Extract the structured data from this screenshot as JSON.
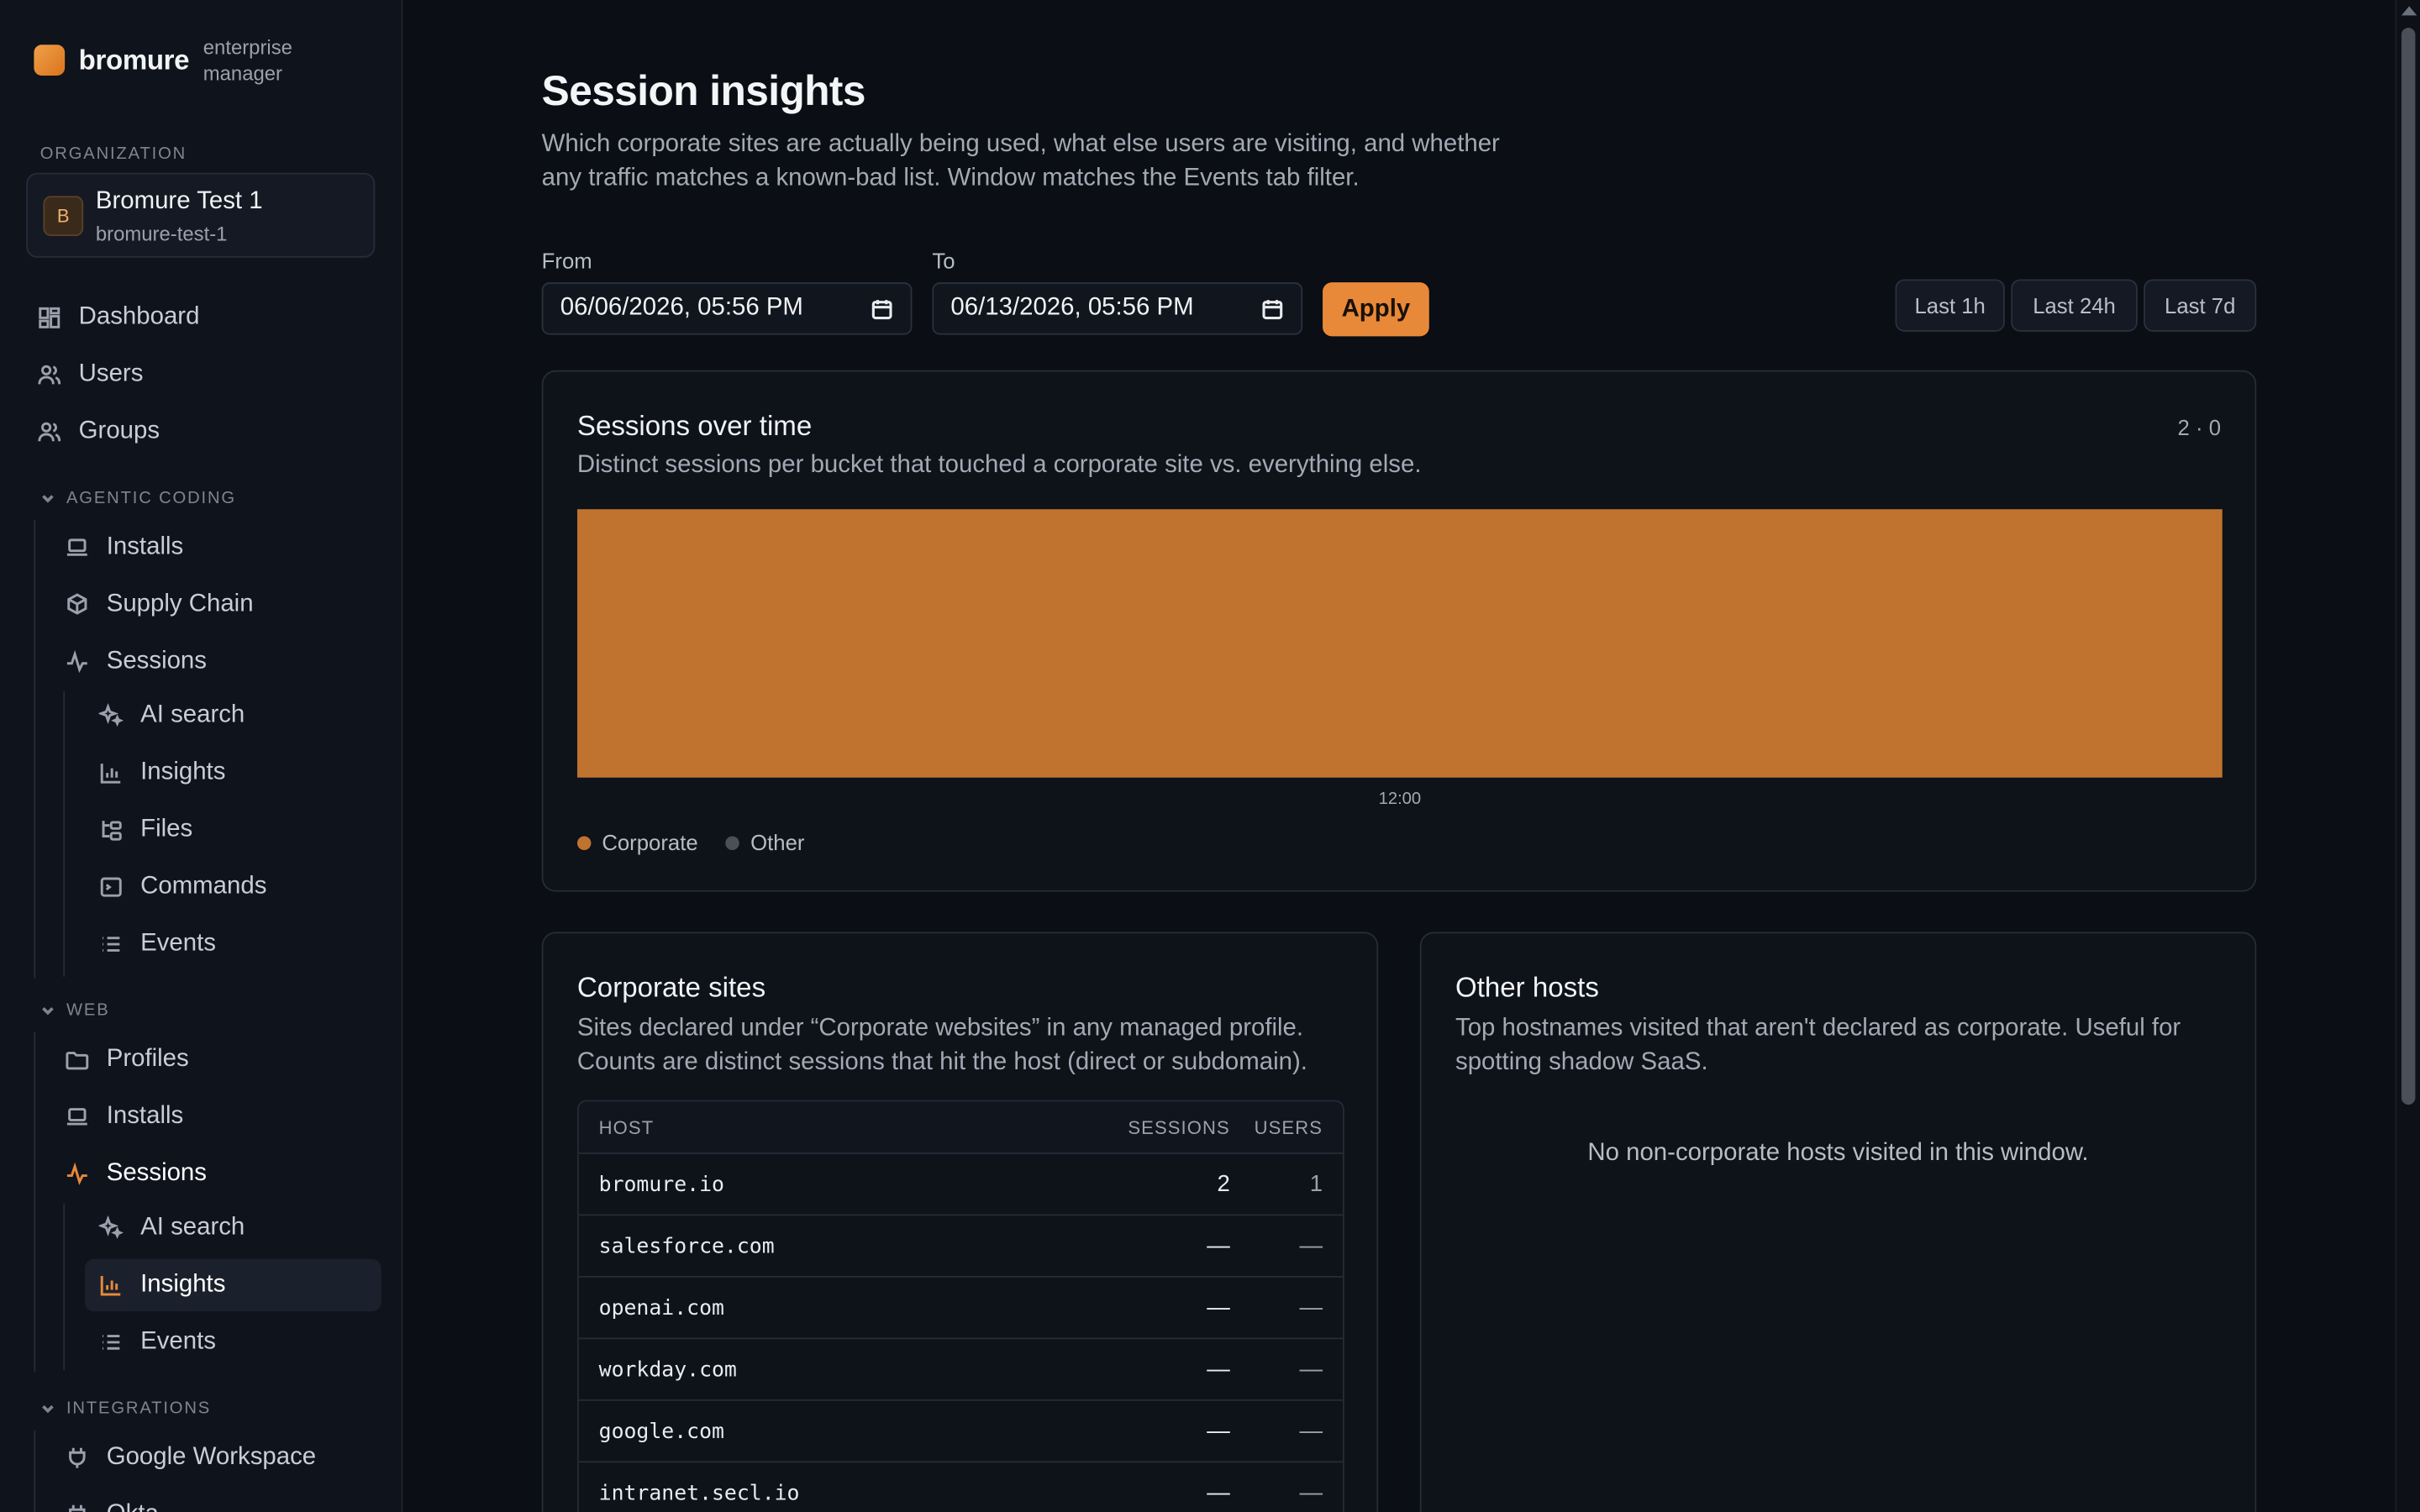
{
  "brand": {
    "name": "bromure",
    "subtitle": "enterprise manager"
  },
  "org": {
    "section_label": "ORGANIZATION",
    "avatar": "B",
    "name": "Bromure Test 1",
    "slug": "bromure-test-1"
  },
  "nav": {
    "dashboard": "Dashboard",
    "users": "Users",
    "groups": "Groups",
    "agentic_head": "AGENTIC CODING",
    "agentic_installs": "Installs",
    "supply_chain": "Supply Chain",
    "agentic_sessions": "Sessions",
    "agentic_ai_search": "AI search",
    "agentic_insights": "Insights",
    "files": "Files",
    "commands": "Commands",
    "agentic_events": "Events",
    "web_head": "WEB",
    "profiles": "Profiles",
    "web_installs": "Installs",
    "web_sessions": "Sessions",
    "web_ai_search": "AI search",
    "web_insights": "Insights",
    "web_events": "Events",
    "integrations_head": "INTEGRATIONS",
    "google_workspace": "Google Workspace",
    "okta": "Okta"
  },
  "page": {
    "title": "Session insights",
    "subtitle": "Which corporate sites are actually being used, what else users are visiting, and whether any traffic matches a known-bad list. Window matches the Events tab filter."
  },
  "filters": {
    "from_label": "From",
    "from_value": "06/06/2026, 05:56 PM",
    "to_label": "To",
    "to_value": "06/13/2026, 05:56 PM",
    "apply": "Apply",
    "quick_ranges": [
      "Last 1h",
      "Last 24h",
      "Last 7d"
    ]
  },
  "sessions_card": {
    "title": "Sessions over time",
    "subtitle": "Distinct sessions per bucket that touched a corporate site vs. everything else.",
    "counter": "2 · 0",
    "legend_corporate": "Corporate",
    "legend_other": "Other"
  },
  "colors": {
    "accent": "#e8893a",
    "corporate": "#c0732f",
    "other": "#4a4f58"
  },
  "chart_data": {
    "type": "bar",
    "categories": [
      "12:00"
    ],
    "series": [
      {
        "name": "Corporate",
        "values": [
          2
        ]
      },
      {
        "name": "Other",
        "values": [
          0
        ]
      }
    ],
    "stacked": true,
    "grid": false,
    "legend": "bottom-left"
  },
  "corporate_card": {
    "title": "Corporate sites",
    "subtitle": "Sites declared under “Corporate websites” in any managed profile. Counts are distinct sessions that hit the host (direct or subdomain).",
    "columns": {
      "host": "HOST",
      "sessions": "SESSIONS",
      "users": "USERS"
    },
    "rows": [
      {
        "host": "bromure.io",
        "sessions": "2",
        "users": "1"
      },
      {
        "host": "salesforce.com",
        "sessions": "—",
        "users": "—"
      },
      {
        "host": "openai.com",
        "sessions": "—",
        "users": "—"
      },
      {
        "host": "workday.com",
        "sessions": "—",
        "users": "—"
      },
      {
        "host": "google.com",
        "sessions": "—",
        "users": "—"
      },
      {
        "host": "intranet.secl.io",
        "sessions": "—",
        "users": "—"
      }
    ]
  },
  "other_card": {
    "title": "Other hosts",
    "subtitle": "Top hostnames visited that aren't declared as corporate. Useful for spotting shadow SaaS.",
    "empty": "No non-corporate hosts visited in this window."
  }
}
